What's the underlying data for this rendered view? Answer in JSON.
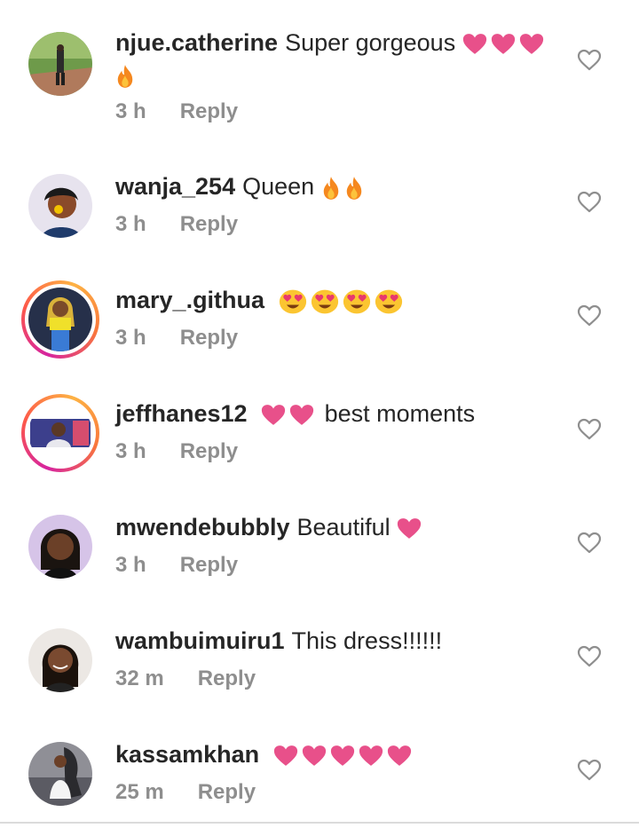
{
  "comments": [
    {
      "username": "njue.catherine",
      "text": "Super gorgeous",
      "time": "3 h",
      "reply": "Reply"
    },
    {
      "username": "wanja_254",
      "text": "Queen",
      "time": "3 h",
      "reply": "Reply"
    },
    {
      "username": "mary_.githua",
      "text": "",
      "time": "3 h",
      "reply": "Reply"
    },
    {
      "username": "jeffhanes12",
      "text": "best moments",
      "time": "3 h",
      "reply": "Reply"
    },
    {
      "username": "mwendebubbly",
      "text": "Beautiful",
      "time": "3 h",
      "reply": "Reply"
    },
    {
      "username": "wambuimuiru1",
      "text": "This dress!!!!!!",
      "time": "32 m",
      "reply": "Reply"
    },
    {
      "username": "kassamkhan",
      "text": "",
      "time": "25 m",
      "reply": "Reply"
    }
  ],
  "colors": {
    "username": "#262626",
    "meta": "#8e8e8e",
    "emoji_heart": "#e8508a",
    "fire": "#f5881f",
    "story_ring": "#fd5949"
  },
  "icons": {
    "like": "heart-outline-icon",
    "pink_heart": "pink-heart-emoji",
    "fire": "fire-emoji",
    "heart_eyes": "heart-eyes-emoji"
  }
}
